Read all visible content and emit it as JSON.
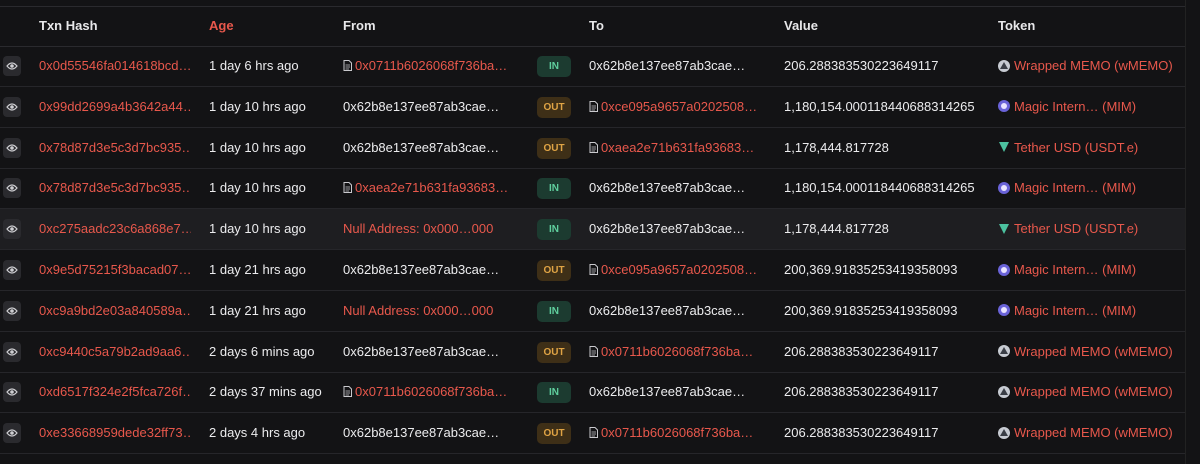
{
  "headers": {
    "txn_hash": "Txn Hash",
    "age": "Age",
    "from": "From",
    "to": "To",
    "value": "Value",
    "token": "Token"
  },
  "colors": {
    "accent_red": "#e8584c",
    "in_green": "#5fcf9e",
    "out_orange": "#e0a445"
  },
  "rows": [
    {
      "hash": "0x0d55546fa014618bcd…",
      "age": "1 day 6 hrs ago",
      "from": "0x0711b6026068f736ba…",
      "from_link": true,
      "from_doc": true,
      "dir": "IN",
      "to": "0x62b8e137ee87ab3cae…",
      "to_link": false,
      "to_doc": false,
      "value": "206.288383530223649117",
      "token": "Wrapped MEMO (wMEMO)",
      "token_icon": "memo-icon"
    },
    {
      "hash": "0x99dd2699a4b3642a44…",
      "age": "1 day 10 hrs ago",
      "from": "0x62b8e137ee87ab3cae…",
      "from_link": false,
      "from_doc": false,
      "dir": "OUT",
      "to": "0xce095a9657a0202508…",
      "to_link": true,
      "to_doc": true,
      "value": "1,180,154.000118440688314265",
      "token": "Magic Intern… (MIM)",
      "token_icon": "mim-icon"
    },
    {
      "hash": "0x78d87d3e5c3d7bc935…",
      "age": "1 day 10 hrs ago",
      "from": "0x62b8e137ee87ab3cae…",
      "from_link": false,
      "from_doc": false,
      "dir": "OUT",
      "to": "0xaea2e71b631fa93683…",
      "to_link": true,
      "to_doc": true,
      "value": "1,178,444.817728",
      "token": "Tether USD (USDT.e)",
      "token_icon": "usdt-icon"
    },
    {
      "hash": "0x78d87d3e5c3d7bc935…",
      "age": "1 day 10 hrs ago",
      "from": "0xaea2e71b631fa93683…",
      "from_link": true,
      "from_doc": true,
      "dir": "IN",
      "to": "0x62b8e137ee87ab3cae…",
      "to_link": false,
      "to_doc": false,
      "value": "1,180,154.000118440688314265",
      "token": "Magic Intern… (MIM)",
      "token_icon": "mim-icon"
    },
    {
      "hash": "0xc275aadc23c6a868e7…",
      "age": "1 day 10 hrs ago",
      "from": "Null Address: 0x000…000",
      "from_link": true,
      "from_doc": false,
      "dir": "IN",
      "to": "0x62b8e137ee87ab3cae…",
      "to_link": false,
      "to_doc": false,
      "value": "1,178,444.817728",
      "token": "Tether USD (USDT.e)",
      "token_icon": "usdt-icon",
      "highlight": true
    },
    {
      "hash": "0x9e5d75215f3bacad07…",
      "age": "1 day 21 hrs ago",
      "from": "0x62b8e137ee87ab3cae…",
      "from_link": false,
      "from_doc": false,
      "dir": "OUT",
      "to": "0xce095a9657a0202508…",
      "to_link": true,
      "to_doc": true,
      "value": "200,369.91835253419358093",
      "token": "Magic Intern… (MIM)",
      "token_icon": "mim-icon"
    },
    {
      "hash": "0xc9a9bd2e03a840589a…",
      "age": "1 day 21 hrs ago",
      "from": "Null Address: 0x000…000",
      "from_link": true,
      "from_doc": false,
      "dir": "IN",
      "to": "0x62b8e137ee87ab3cae…",
      "to_link": false,
      "to_doc": false,
      "value": "200,369.91835253419358093",
      "token": "Magic Intern… (MIM)",
      "token_icon": "mim-icon"
    },
    {
      "hash": "0xc9440c5a79b2ad9aa6…",
      "age": "2 days 6 mins ago",
      "from": "0x62b8e137ee87ab3cae…",
      "from_link": false,
      "from_doc": false,
      "dir": "OUT",
      "to": "0x0711b6026068f736ba…",
      "to_link": true,
      "to_doc": true,
      "value": "206.288383530223649117",
      "token": "Wrapped MEMO (wMEMO)",
      "token_icon": "memo-icon"
    },
    {
      "hash": "0xd6517f324e2f5fca726f…",
      "age": "2 days 37 mins ago",
      "from": "0x0711b6026068f736ba…",
      "from_link": true,
      "from_doc": true,
      "dir": "IN",
      "to": "0x62b8e137ee87ab3cae…",
      "to_link": false,
      "to_doc": false,
      "value": "206.288383530223649117",
      "token": "Wrapped MEMO (wMEMO)",
      "token_icon": "memo-icon"
    },
    {
      "hash": "0xe33668959dede32ff73…",
      "age": "2 days 4 hrs ago",
      "from": "0x62b8e137ee87ab3cae…",
      "from_link": false,
      "from_doc": false,
      "dir": "OUT",
      "to": "0x0711b6026068f736ba…",
      "to_link": true,
      "to_doc": true,
      "value": "206.288383530223649117",
      "token": "Wrapped MEMO (wMEMO)",
      "token_icon": "memo-icon"
    }
  ]
}
